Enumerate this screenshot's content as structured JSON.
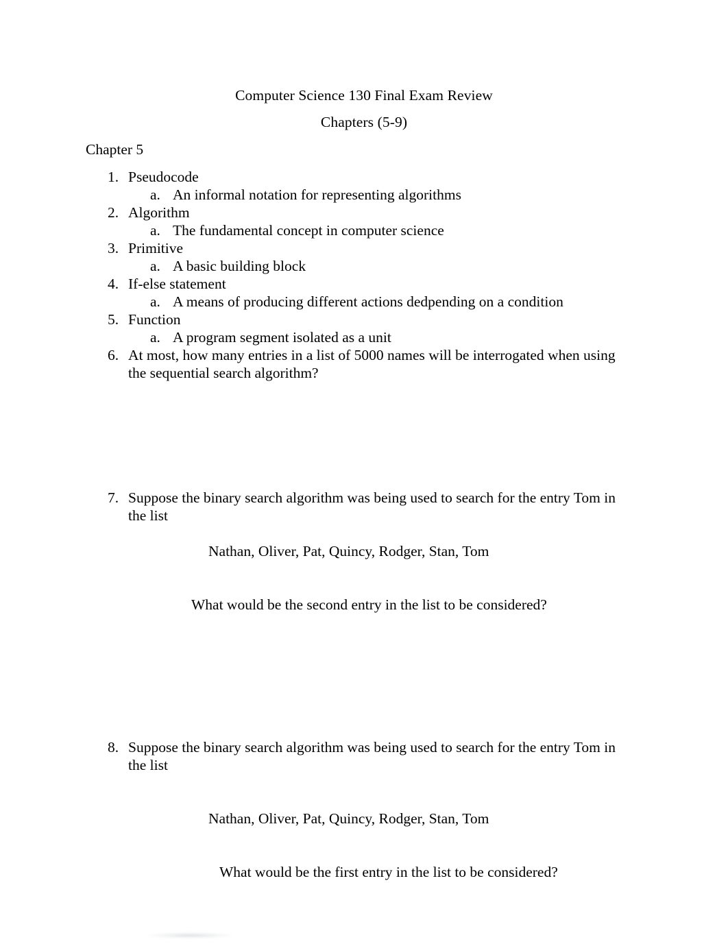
{
  "document": {
    "title": "Computer Science 130 Final Exam Review",
    "subtitle": "Chapters (5-9)",
    "section_heading": "Chapter 5"
  },
  "outline": [
    {
      "number": "1.",
      "text": "Pseudocode",
      "sub": {
        "marker": "a.",
        "text": "An informal notation for representing algorithms"
      }
    },
    {
      "number": "2.",
      "text": "Algorithm",
      "sub": {
        "marker": "a.",
        "text": "The fundamental concept in computer science"
      }
    },
    {
      "number": "3.",
      "text": "Primitive",
      "sub": {
        "marker": "a.",
        "text": "A basic building block"
      }
    },
    {
      "number": "4.",
      "text": "If-else statement",
      "sub": {
        "marker": "a.",
        "text": "A means of producing different actions dedpending on a condition"
      }
    },
    {
      "number": "5.",
      "text": "Function",
      "sub": {
        "marker": "a.",
        "text": "A program segment isolated as a unit"
      }
    },
    {
      "number": "6.",
      "text": "At most, how many entries in a list of 5000 names will be interrogated when using the sequential search algorithm?"
    },
    {
      "number": "7.",
      "text": "Suppose the binary search algorithm was being used to search for the entry Tom in the list",
      "names_line": "Nathan, Oliver, Pat, Quincy, Rodger, Stan, Tom",
      "question_line": "What would be the second entry in the list to be considered?"
    },
    {
      "number": "8.",
      "text": "Suppose the binary search algorithm was being used to search for the entry Tom in the list",
      "names_line": "Nathan, Oliver, Pat, Quincy, Rodger, Stan, Tom",
      "question_line": "What would be the first entry in the list to be considered?"
    }
  ],
  "colors": {
    "page_background": "#ffffff",
    "text": "#000000"
  }
}
